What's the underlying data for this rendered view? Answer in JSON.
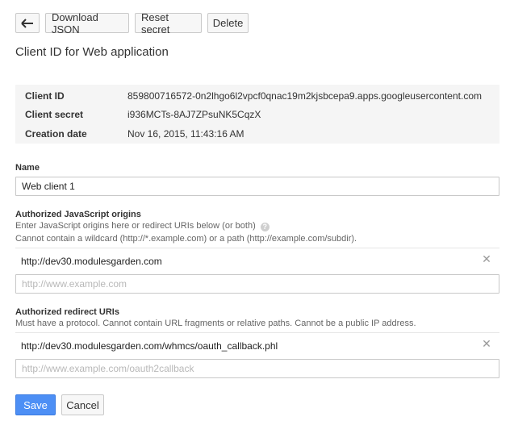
{
  "toolbar": {
    "back_icon": "arrow-left-icon",
    "download_label": "Download JSON",
    "reset_label": "Reset secret",
    "delete_label": "Delete"
  },
  "page": {
    "title": "Client ID for Web application"
  },
  "info": {
    "client_id_label": "Client ID",
    "client_id_value": "859800716572-0n2lhgo6l2vpcf0qnac19m2kjsbcepa9.apps.googleusercontent.com",
    "client_secret_label": "Client secret",
    "client_secret_value": "i936MCTs-8AJ7ZPsuNK5CqzX",
    "creation_date_label": "Creation date",
    "creation_date_value": "Nov 16, 2015, 11:43:16 AM"
  },
  "name_field": {
    "label": "Name",
    "value": "Web client 1"
  },
  "js_origins": {
    "label": "Authorized JavaScript origins",
    "help_line1": "Enter JavaScript origins here or redirect URIs below (or both)",
    "help_line2": "Cannot contain a wildcard (http://*.example.com) or a path (http://example.com/subdir).",
    "entries": [
      "http://dev30.modulesgarden.com"
    ],
    "placeholder": "http://www.example.com",
    "help_icon": "question-circle-icon"
  },
  "redirect_uris": {
    "label": "Authorized redirect URIs",
    "help_line1": "Must have a protocol. Cannot contain URL fragments or relative paths. Cannot be a public IP address.",
    "entries": [
      "http://dev30.modulesgarden.com/whmcs/oauth_callback.phl"
    ],
    "placeholder": "http://www.example.com/oauth2callback"
  },
  "actions": {
    "save_label": "Save",
    "cancel_label": "Cancel"
  },
  "colors": {
    "primary": "#4d8ff5",
    "panel_bg": "#f5f5f5"
  }
}
